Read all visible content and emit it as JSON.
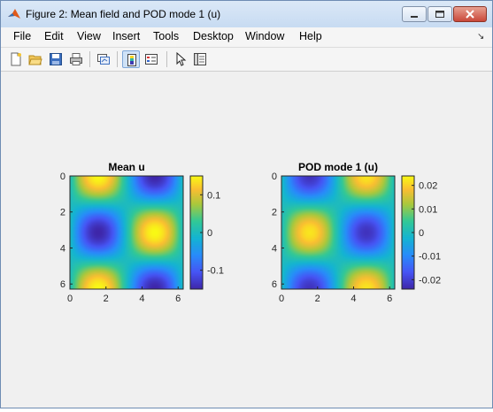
{
  "window": {
    "title": "Figure 2: Mean field and POD mode 1 (u)"
  },
  "menu": [
    "File",
    "Edit",
    "View",
    "Insert",
    "Tools",
    "Desktop",
    "Window",
    "Help"
  ],
  "toolbar_icons": [
    "new-figure-icon",
    "open-file-icon",
    "save-icon",
    "print-icon",
    "link-plot-icon",
    "colorbar-icon",
    "legend-icon",
    "select-arrow-icon",
    "property-inspector-icon"
  ],
  "chart_data": [
    {
      "type": "heatmap",
      "title": "Mean u",
      "x_ticks": [
        "0",
        "2",
        "4",
        "6"
      ],
      "y_ticks": [
        "0",
        "2",
        "4",
        "6"
      ],
      "xlim": [
        0,
        6.283
      ],
      "ylim": [
        0,
        6.283
      ],
      "y_direction": "down",
      "field": "sin(x)*cos(y)",
      "amplitude": 0.15,
      "colorbar": {
        "ticks": [
          "0.1",
          "0",
          "-0.1"
        ],
        "tick_values": [
          0.1,
          0,
          -0.1
        ],
        "clim": [
          -0.15,
          0.15
        ]
      }
    },
    {
      "type": "heatmap",
      "title": "POD mode 1 (u)",
      "x_ticks": [
        "0",
        "2",
        "4",
        "6"
      ],
      "y_ticks": [
        "0",
        "2",
        "4",
        "6"
      ],
      "xlim": [
        0,
        6.283
      ],
      "ylim": [
        0,
        6.283
      ],
      "y_direction": "down",
      "field": "-sin(x)*cos(y)",
      "amplitude": 0.022,
      "colorbar": {
        "ticks": [
          "0.02",
          "0.01",
          "0",
          "-0.01",
          "-0.02"
        ],
        "tick_values": [
          0.02,
          0.01,
          0,
          -0.01,
          -0.02
        ],
        "clim": [
          -0.024,
          0.024
        ]
      }
    }
  ]
}
